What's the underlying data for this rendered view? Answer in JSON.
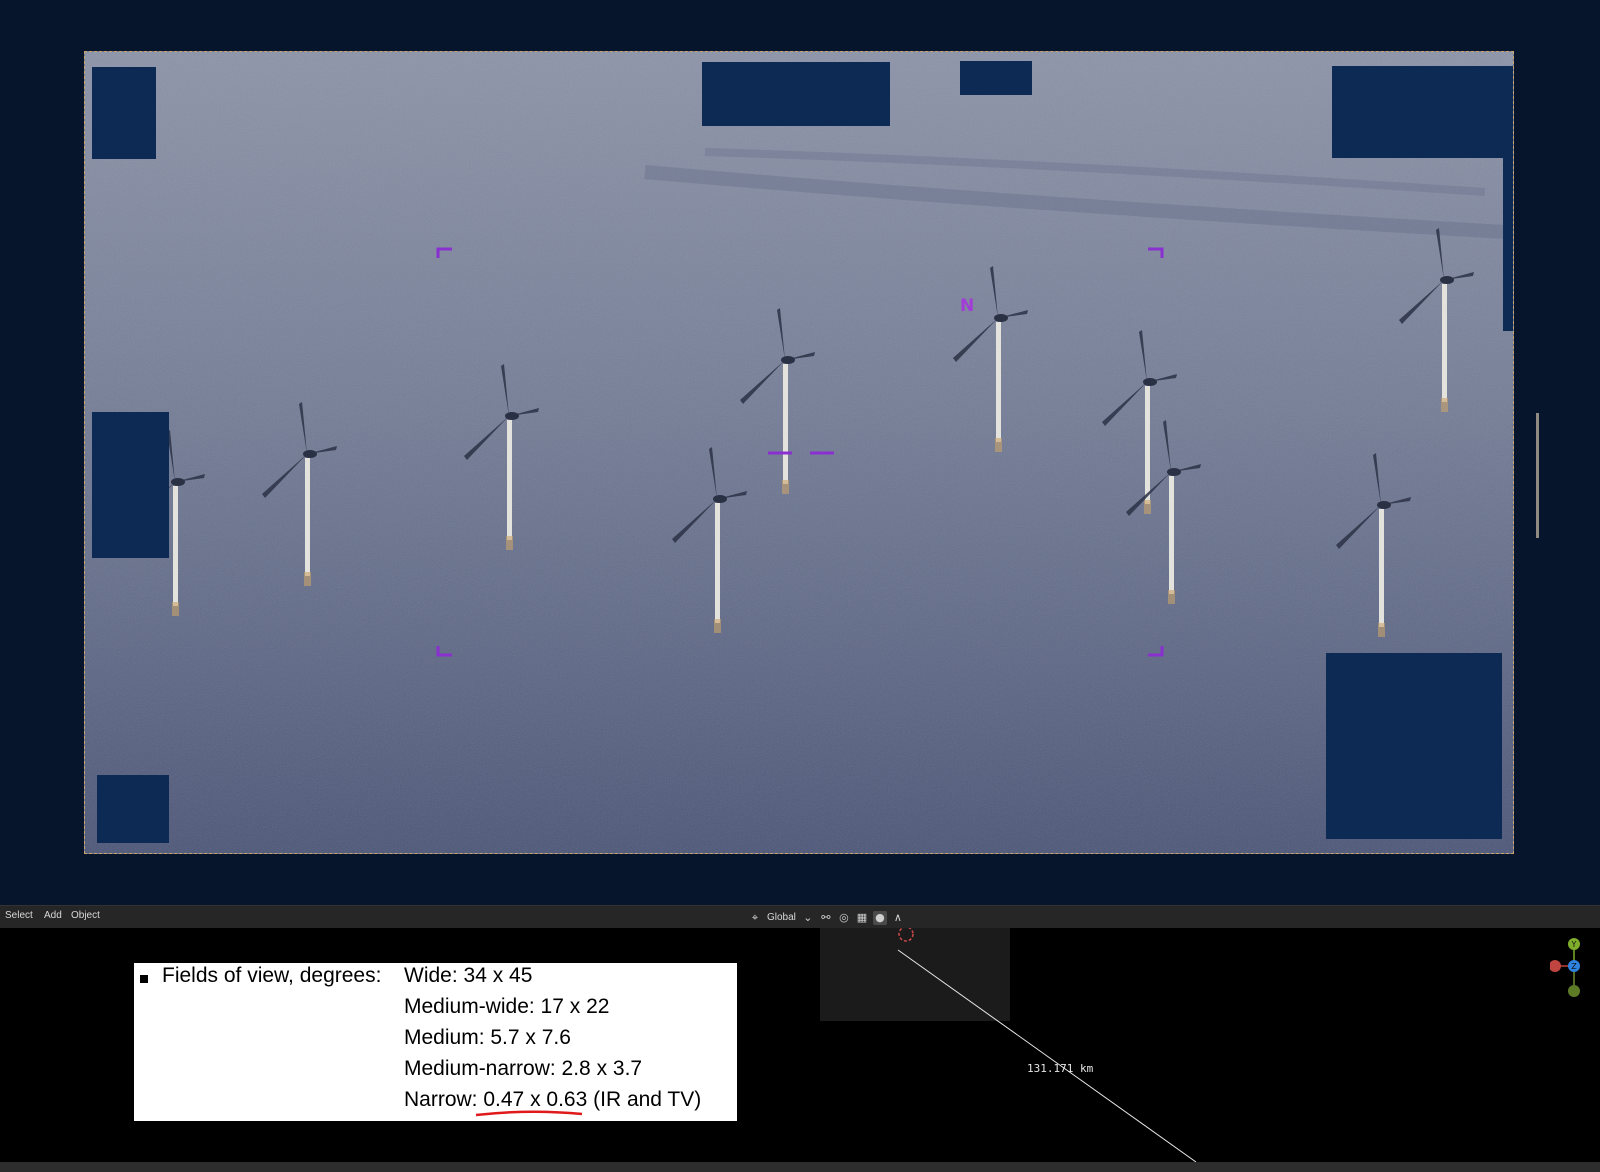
{
  "viewport": {
    "north_label": "N"
  },
  "toolbar": {
    "select_label": "Select",
    "add_label": "Add",
    "object_label": "Object",
    "orientation_label": "Global"
  },
  "fov_slide": {
    "title": "Fields of view, degrees:",
    "lines": [
      "Wide: 34 x 45",
      "Medium-wide: 17 x 22",
      "Medium: 5.7 x 7.6",
      "Medium-narrow: 2.8 x 3.7"
    ],
    "narrow_prefix": "Narrow: ",
    "narrow_value": "0.47 x 0.63",
    "narrow_suffix": " (IR and TV)"
  },
  "measure": {
    "distance": "131.171 km"
  },
  "colors": {
    "viewport_bg": "#07152c",
    "mask": "#0d2a55",
    "reticle": "#8a2fd0",
    "underline": "#e0191a",
    "axis_x": "#c0443f",
    "axis_y": "#7fae2a",
    "axis_z": "#2f83e0"
  },
  "icons": [
    "transform-pivot-icon",
    "chevron-down-icon",
    "snap-link-icon",
    "proportional-icon",
    "snap-grid-icon",
    "record-icon",
    "falloff-icon",
    "cursor-3d-icon",
    "navigation-gizmo-icon"
  ]
}
